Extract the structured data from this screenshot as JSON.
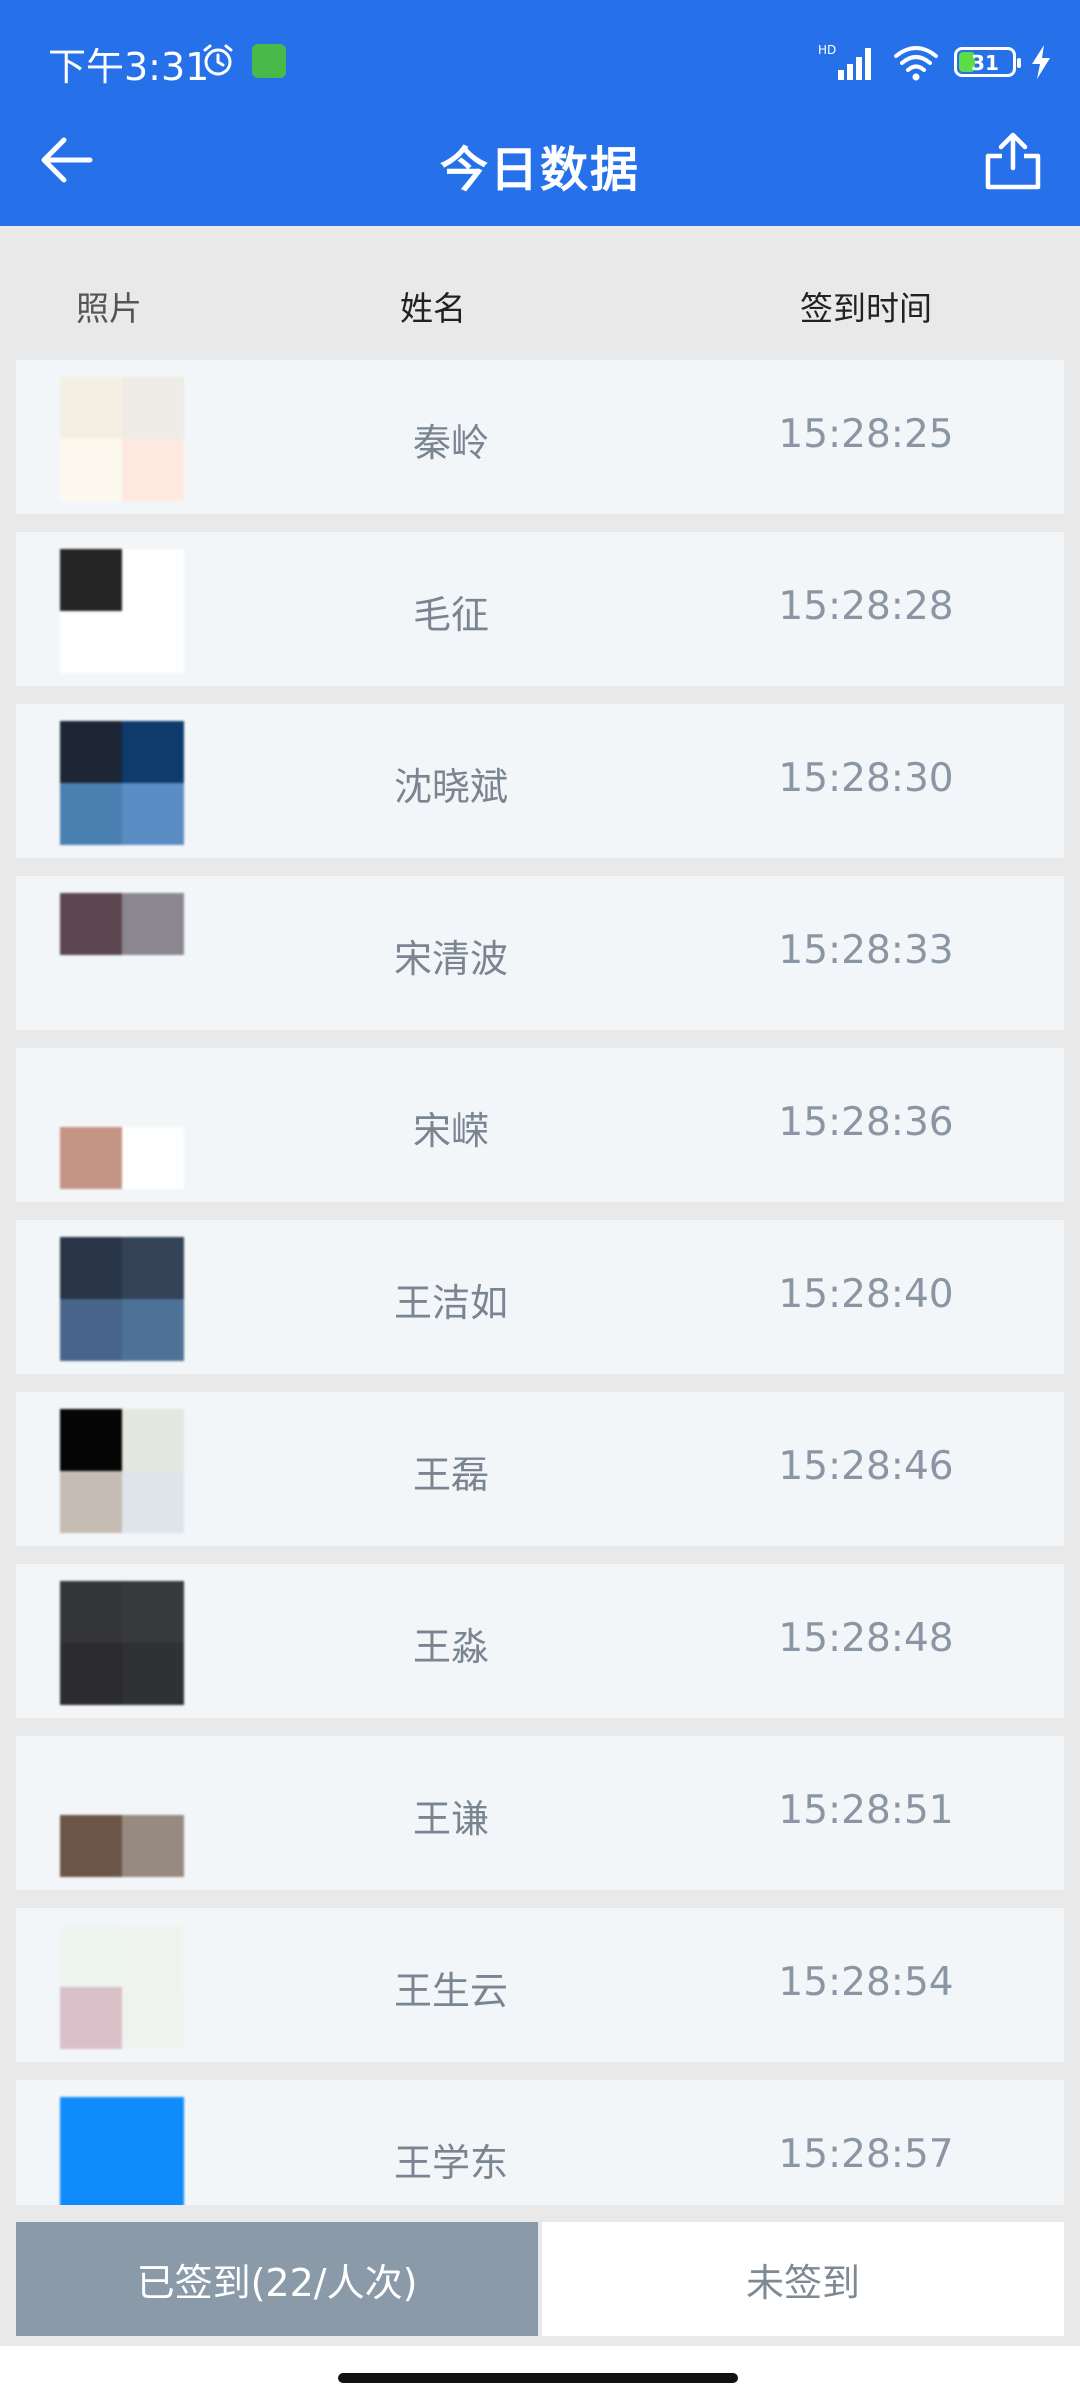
{
  "status_bar": {
    "time": "下午3:31",
    "network": "HD",
    "battery": "31",
    "battery_level": 0.31
  },
  "header": {
    "title": "今日数据",
    "back_icon": "arrow-left-icon",
    "share_icon": "share-icon"
  },
  "columns": {
    "photo": "照片",
    "name": "姓名",
    "time": "签到时间"
  },
  "rows": [
    {
      "name": "秦岭",
      "time": "15:28:25",
      "photo_colors": [
        "#f3f0e3",
        "#efebe6",
        "#fdf9ef",
        "#fde9e0"
      ]
    },
    {
      "name": "毛征",
      "time": "15:28:28",
      "photo_colors": [
        "#252525",
        "#fefefe",
        "#fefefe",
        "#fefefe"
      ]
    },
    {
      "name": "沈晓斌",
      "time": "15:28:30",
      "photo_colors": [
        "#1c2635",
        "#0d3b6c",
        "#4a7fb2",
        "#5c8cc4"
      ]
    },
    {
      "name": "宋清波",
      "time": "15:28:33",
      "photo_colors": [
        "#5b4650",
        "#8b8790",
        "#f3f6f9",
        "#f3f6f9"
      ]
    },
    {
      "name": "宋嵘",
      "time": "15:28:36",
      "photo_colors": [
        "#f3f6f9",
        "#f3f6f9",
        "#c49485",
        "#fefefe"
      ]
    },
    {
      "name": "王洁如",
      "time": "15:28:40",
      "photo_colors": [
        "#293547",
        "#334256",
        "#47658a",
        "#4e7296"
      ]
    },
    {
      "name": "王磊",
      "time": "15:28:46",
      "photo_colors": [
        "#050505",
        "#e3e7e0",
        "#c5bcb4",
        "#dde5ea"
      ]
    },
    {
      "name": "王淼",
      "time": "15:28:48",
      "photo_colors": [
        "#343539",
        "#38393d",
        "#2c2b2e",
        "#303133"
      ]
    },
    {
      "name": "王谦",
      "time": "15:28:51",
      "photo_colors": [
        "#f3f6f9",
        "#f3f6f9",
        "#6c5547",
        "#978a80"
      ]
    },
    {
      "name": "王生云",
      "time": "15:28:54",
      "photo_colors": [
        "#edf5ee",
        "#eff5ee",
        "#d9c0c9",
        "#eef4ed"
      ]
    },
    {
      "name": "王学东",
      "time": "15:28:57",
      "photo_colors": [
        "#0f8cfb",
        "#0f8cfb",
        "#0f8cfb",
        "#0f8cfb"
      ]
    }
  ],
  "tabs": {
    "signed": "已签到(22/人次)",
    "unsigned": "未签到"
  },
  "colors": {
    "primary": "#2670ea",
    "tab_active": "#8a9aa9",
    "row_bg": "#f3f6f9"
  }
}
